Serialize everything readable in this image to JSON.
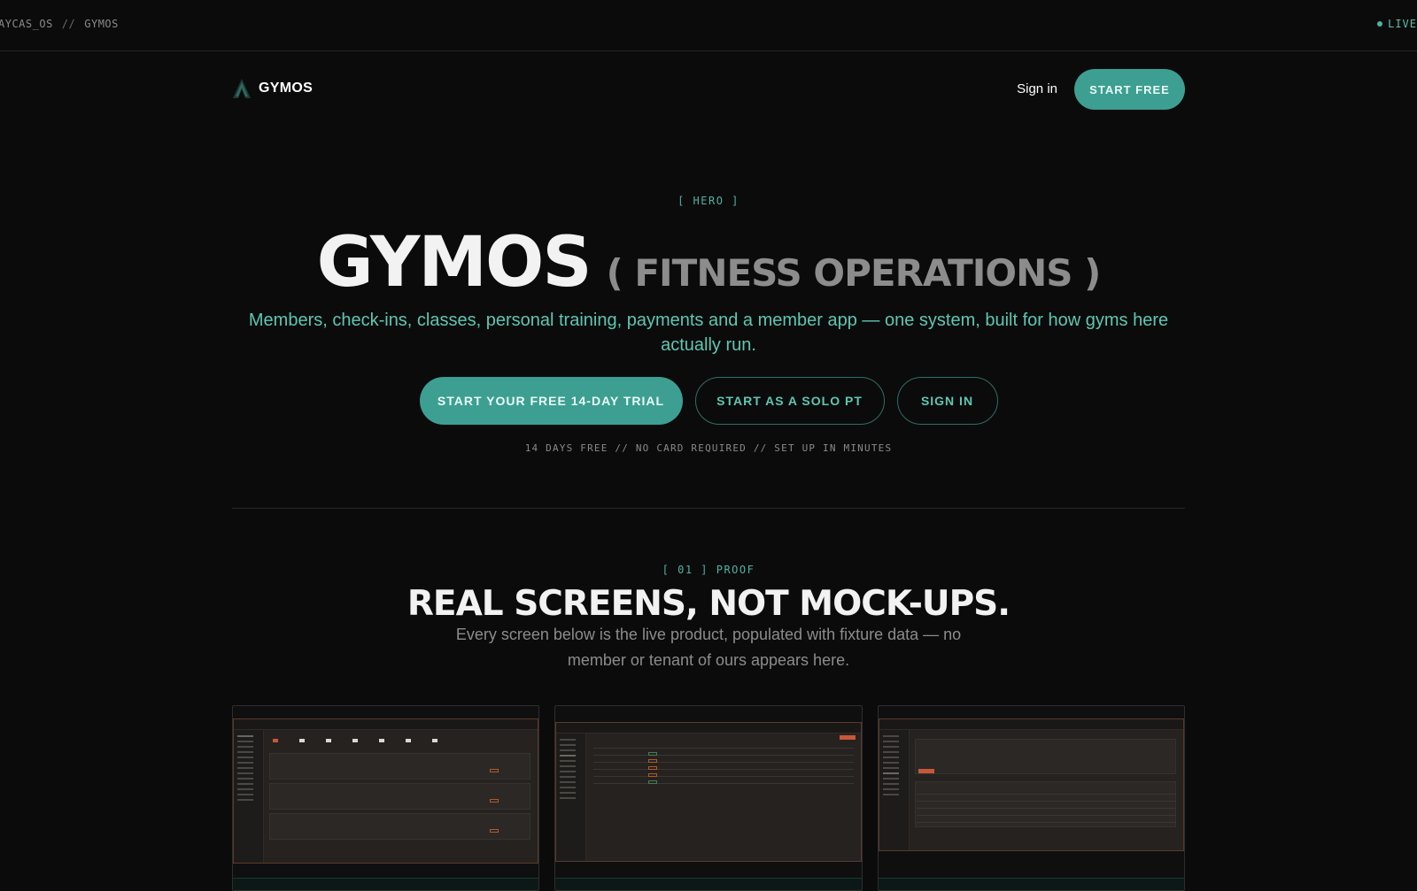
{
  "topbar": {
    "crumb_left": "AYCAS_OS",
    "crumb_sep": "//",
    "crumb_right": "GYMOS",
    "live": "LIVE"
  },
  "nav": {
    "brand": "GYMOS",
    "signin": "Sign in",
    "start_free": "START FREE"
  },
  "hero": {
    "tag": "[ HERO ]",
    "title": "GYMOS",
    "subtitle": "( FITNESS OPERATIONS )",
    "description": "Members, check-ins, classes, personal training, payments and a member app — one system, built for how gyms here actually run.",
    "cta_primary": "START YOUR FREE 14-DAY TRIAL",
    "cta_solo": "START AS A SOLO PT",
    "cta_signin": "SIGN IN",
    "fine_print": "14 DAYS FREE // NO CARD REQUIRED // SET UP IN MINUTES"
  },
  "proof": {
    "tag": "[ 01 ] PROOF",
    "title": "REAL SCREENS, NOT MOCK-UPS.",
    "description": "Every screen below is the live product, populated with fixture data — no member or tenant of ours appears here."
  },
  "colors": {
    "accent": "#3c9f91",
    "accent_text": "#5fc7b2",
    "background": "#0b0b0b",
    "screen_highlight": "#c8573a"
  }
}
